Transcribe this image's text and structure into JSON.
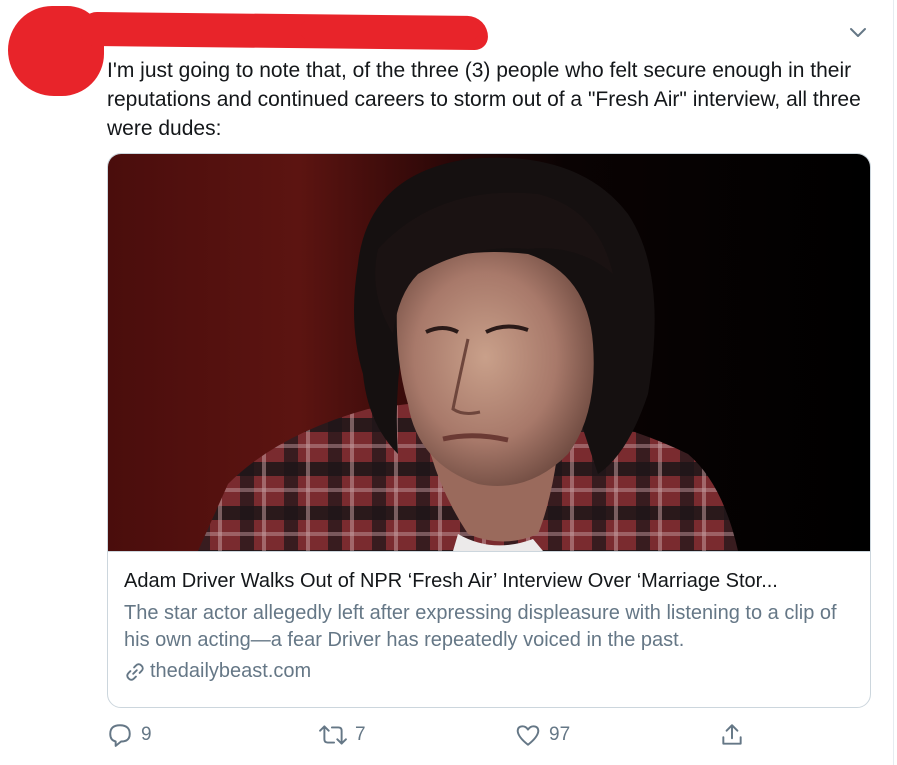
{
  "tweet": {
    "text": "I'm just going to note that, of the three (3) people who felt secure enough in their reputations and continued careers to storm out of a \"Fresh Air\" interview, all three were dudes:",
    "menu_icon": "chevron-down-icon"
  },
  "card": {
    "title": "Adam Driver Walks Out of NPR ‘Fresh Air’ Interview Over ‘Marriage Stor...",
    "description": "The star actor allegedly left after expressing displeasure with listening to a clip of his own acting—a fear Driver has repeatedly voiced in the past.",
    "domain": "thedailybeast.com",
    "domain_icon": "link-icon"
  },
  "actions": {
    "reply_count": "9",
    "retweet_count": "7",
    "like_count": "97",
    "reply_icon": "reply-icon",
    "retweet_icon": "retweet-icon",
    "like_icon": "heart-icon",
    "share_icon": "share-icon"
  },
  "colors": {
    "redaction": "#e8242a",
    "muted": "#657786",
    "text": "#14171a",
    "border": "#ccd6dd"
  }
}
